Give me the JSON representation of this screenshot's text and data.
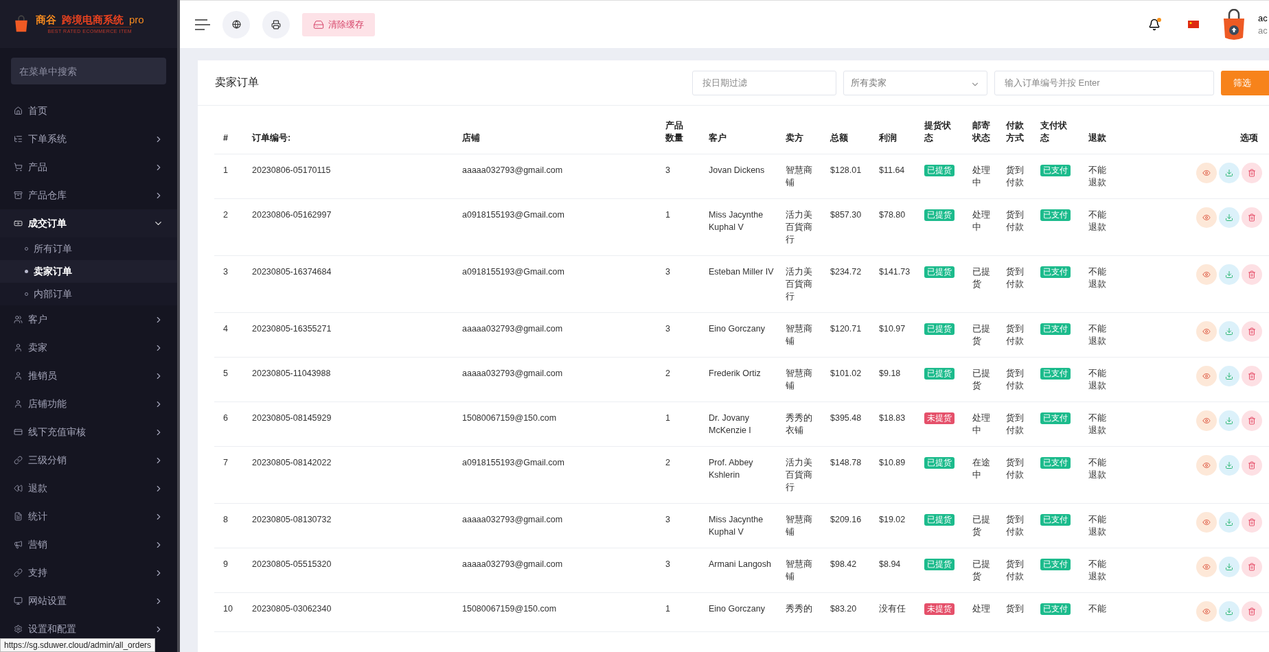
{
  "logo": {
    "name": "商谷",
    "product": "跨境电商系统",
    "edition": "pro",
    "tagline": "BEST RATED ECOMMERCE ITEM"
  },
  "sidebar": {
    "search": {
      "placeholder": "在菜单中搜索"
    },
    "items": [
      {
        "label": "首页",
        "kind": "link",
        "expanded": false,
        "selected": false
      },
      {
        "label": "下单系统",
        "kind": "group",
        "expanded": false,
        "selected": false
      },
      {
        "label": "产品",
        "kind": "group",
        "expanded": false,
        "selected": false
      },
      {
        "label": "产品仓库",
        "kind": "group",
        "expanded": false,
        "selected": false
      },
      {
        "label": "成交订单",
        "kind": "group",
        "expanded": true,
        "selected": true,
        "children": [
          {
            "label": "所有订单",
            "selected": false
          },
          {
            "label": "卖家订单",
            "selected": true
          },
          {
            "label": "内部订单",
            "selected": false
          }
        ]
      },
      {
        "label": "客户",
        "kind": "group",
        "expanded": false,
        "selected": false
      },
      {
        "label": "卖家",
        "kind": "group",
        "expanded": false,
        "selected": false
      },
      {
        "label": "推销员",
        "kind": "group",
        "expanded": false,
        "selected": false
      },
      {
        "label": "店铺功能",
        "kind": "group",
        "expanded": false,
        "selected": false
      },
      {
        "label": "线下充值审核",
        "kind": "group",
        "expanded": false,
        "selected": false
      },
      {
        "label": "三级分销",
        "kind": "group",
        "expanded": false,
        "selected": false
      },
      {
        "label": "退款",
        "kind": "group",
        "expanded": false,
        "selected": false
      },
      {
        "label": "统计",
        "kind": "group",
        "expanded": false,
        "selected": false
      },
      {
        "label": "营销",
        "kind": "group",
        "expanded": false,
        "selected": false
      },
      {
        "label": "支持",
        "kind": "group",
        "expanded": false,
        "selected": false
      },
      {
        "label": "网站设置",
        "kind": "group",
        "expanded": false,
        "selected": false
      },
      {
        "label": "设置和配置",
        "kind": "group",
        "expanded": false,
        "selected": false
      }
    ]
  },
  "topbar": {
    "clear_cache": "清除缓存",
    "notifications": {
      "unread": true
    },
    "user": {
      "name": "ac",
      "role": "ac"
    }
  },
  "card": {
    "title": "卖家订单",
    "date_filter": {
      "placeholder": "按日期过滤"
    },
    "seller_select": {
      "value": "所有卖家"
    },
    "order_search": {
      "placeholder": "输入订单编号并按 Enter"
    },
    "filter_button": "筛选"
  },
  "table": {
    "columns": [
      "#",
      "订单编号:",
      "店铺",
      "产品数量",
      "客户",
      "卖方",
      "总额",
      "利润",
      "提货状态",
      "邮寄状态",
      "付款方式",
      "支付状态",
      "退款",
      "选项"
    ],
    "rows": [
      {
        "no": "1",
        "order": "20230806-05170115",
        "shop": "aaaaa032793@gmail.com",
        "qty": "3",
        "customer": "Jovan Dickens",
        "seller": "智慧商铺",
        "total": "$128.01",
        "profit": "$11.64",
        "pickup": {
          "label": "已提货",
          "done": true
        },
        "mail": "处理中",
        "payment": "货到付款",
        "paid": {
          "label": "已支付",
          "done": true
        },
        "refund": "不能退款"
      },
      {
        "no": "2",
        "order": "20230806-05162997",
        "shop": "a0918155193@Gmail.com",
        "qty": "1",
        "customer": "Miss Jacynthe Kuphal V",
        "seller": "活力美百貨商行",
        "total": "$857.30",
        "profit": "$78.80",
        "pickup": {
          "label": "已提货",
          "done": true
        },
        "mail": "处理中",
        "payment": "货到付款",
        "paid": {
          "label": "已支付",
          "done": true
        },
        "refund": "不能退款"
      },
      {
        "no": "3",
        "order": "20230805-16374684",
        "shop": "a0918155193@Gmail.com",
        "qty": "3",
        "customer": "Esteban Miller IV",
        "seller": "活力美百貨商行",
        "total": "$234.72",
        "profit": "$141.73",
        "pickup": {
          "label": "已提货",
          "done": true
        },
        "mail": "已提货",
        "payment": "货到付款",
        "paid": {
          "label": "已支付",
          "done": true
        },
        "refund": "不能退款"
      },
      {
        "no": "4",
        "order": "20230805-16355271",
        "shop": "aaaaa032793@gmail.com",
        "qty": "3",
        "customer": "Eino Gorczany",
        "seller": "智慧商铺",
        "total": "$120.71",
        "profit": "$10.97",
        "pickup": {
          "label": "已提货",
          "done": true
        },
        "mail": "已提货",
        "payment": "货到付款",
        "paid": {
          "label": "已支付",
          "done": true
        },
        "refund": "不能退款"
      },
      {
        "no": "5",
        "order": "20230805-11043988",
        "shop": "aaaaa032793@gmail.com",
        "qty": "2",
        "customer": "Frederik Ortiz",
        "seller": "智慧商铺",
        "total": "$101.02",
        "profit": "$9.18",
        "pickup": {
          "label": "已提货",
          "done": true
        },
        "mail": "已提货",
        "payment": "货到付款",
        "paid": {
          "label": "已支付",
          "done": true
        },
        "refund": "不能退款"
      },
      {
        "no": "6",
        "order": "20230805-08145929",
        "shop": "15080067159@150.com",
        "qty": "1",
        "customer": "Dr. Jovany McKenzie I",
        "seller": "秀秀的衣铺",
        "total": "$395.48",
        "profit": "$18.83",
        "pickup": {
          "label": "未提货",
          "done": false
        },
        "mail": "处理中",
        "payment": "货到付款",
        "paid": {
          "label": "已支付",
          "done": true
        },
        "refund": "不能退款"
      },
      {
        "no": "7",
        "order": "20230805-08142022",
        "shop": "a0918155193@Gmail.com",
        "qty": "2",
        "customer": "Prof. Abbey Kshlerin",
        "seller": "活力美百貨商行",
        "total": "$148.78",
        "profit": "$10.89",
        "pickup": {
          "label": "已提货",
          "done": true
        },
        "mail": "在途中",
        "payment": "货到付款",
        "paid": {
          "label": "已支付",
          "done": true
        },
        "refund": "不能退款"
      },
      {
        "no": "8",
        "order": "20230805-08130732",
        "shop": "aaaaa032793@gmail.com",
        "qty": "3",
        "customer": "Miss Jacynthe Kuphal V",
        "seller": "智慧商铺",
        "total": "$209.16",
        "profit": "$19.02",
        "pickup": {
          "label": "已提货",
          "done": true
        },
        "mail": "已提货",
        "payment": "货到付款",
        "paid": {
          "label": "已支付",
          "done": true
        },
        "refund": "不能退款"
      },
      {
        "no": "9",
        "order": "20230805-05515320",
        "shop": "aaaaa032793@gmail.com",
        "qty": "3",
        "customer": "Armani Langosh",
        "seller": "智慧商铺",
        "total": "$98.42",
        "profit": "$8.94",
        "pickup": {
          "label": "已提货",
          "done": true
        },
        "mail": "已提货",
        "payment": "货到付款",
        "paid": {
          "label": "已支付",
          "done": true
        },
        "refund": "不能退款"
      },
      {
        "no": "10",
        "order": "20230805-03062340",
        "shop": "15080067159@150.com",
        "qty": "1",
        "customer": "Eino Gorczany",
        "seller": "秀秀的",
        "total": "$83.20",
        "profit": "没有任",
        "pickup": {
          "label": "未提货",
          "done": false
        },
        "mail": "处理",
        "payment": "货到",
        "paid": {
          "label": "已支付",
          "done": true
        },
        "refund": "不能"
      }
    ]
  },
  "status_url": "https://sg.sduwer.cloud/admin/all_orders"
}
